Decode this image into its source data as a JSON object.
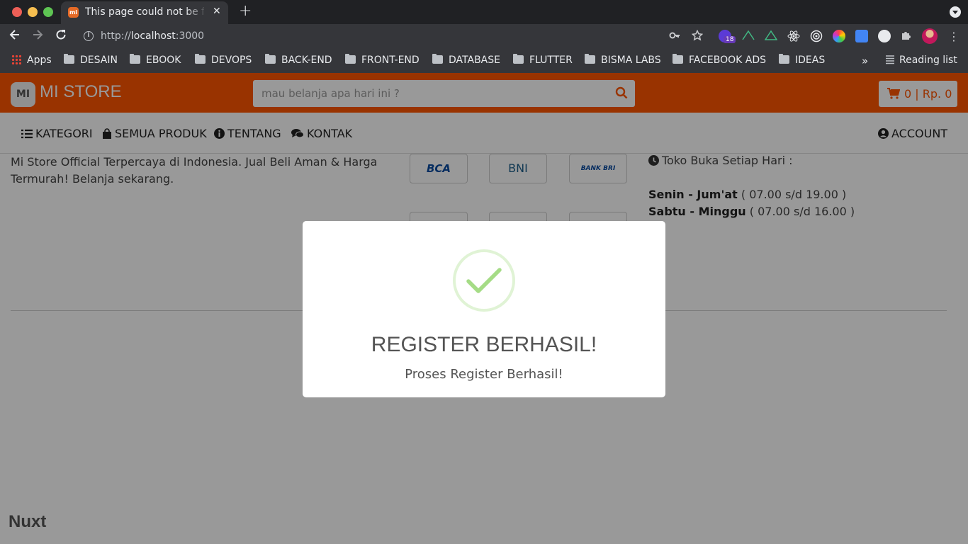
{
  "browser": {
    "tab_title": "This page could not be found",
    "tab_favicon_text": "mi",
    "url_scheme": "http://",
    "url_host": "localhost",
    "url_port": ":3000",
    "extension_badge": "18",
    "bookmarks": [
      {
        "label": "Apps",
        "type": "apps"
      },
      {
        "label": "DESAIN",
        "type": "folder"
      },
      {
        "label": "EBOOK",
        "type": "folder"
      },
      {
        "label": "DEVOPS",
        "type": "folder"
      },
      {
        "label": "BACK-END",
        "type": "folder"
      },
      {
        "label": "FRONT-END",
        "type": "folder"
      },
      {
        "label": "DATABASE",
        "type": "folder"
      },
      {
        "label": "FLUTTER",
        "type": "folder"
      },
      {
        "label": "BISMA LABS",
        "type": "folder"
      },
      {
        "label": "FACEBOOK ADS",
        "type": "folder"
      },
      {
        "label": "IDEAS",
        "type": "folder"
      }
    ],
    "bookmarks_more": "»",
    "reading_list": "Reading list"
  },
  "site": {
    "logo_icon_text": "MI",
    "brand": "MI STORE",
    "search_placeholder": "mau belanja apa hari ini ?",
    "cart_label": "0 | Rp. 0",
    "accent_color": "#ff5500",
    "nav": {
      "kategori": "KATEGORI",
      "semua_produk": "SEMUA PRODUK",
      "tentang": "TENTANG",
      "kontak": "KONTAK",
      "account": "ACCOUNT"
    },
    "about_text": "Mi Store Official Terpercaya di Indonesia. Jual Beli Aman & Harga Termurah! Belanja sekarang.",
    "banks": [
      "BCA",
      "BNI",
      "BANK BRI"
    ],
    "hours_title": "Toko Buka Setiap Hari :",
    "hours": [
      {
        "days": "Senin - Jum'at",
        "time": "( 07.00 s/d 19.00 )"
      },
      {
        "days": "Sabtu - Minggu",
        "time": "( 07.00 s/d 16.00 )"
      }
    ],
    "footer_brand": "Nuxt"
  },
  "modal": {
    "title": "REGISTER BERHASIL!",
    "text": "Proses Register Berhasil!",
    "icon": "success-check-icon",
    "icon_color": "#a5dc86"
  }
}
